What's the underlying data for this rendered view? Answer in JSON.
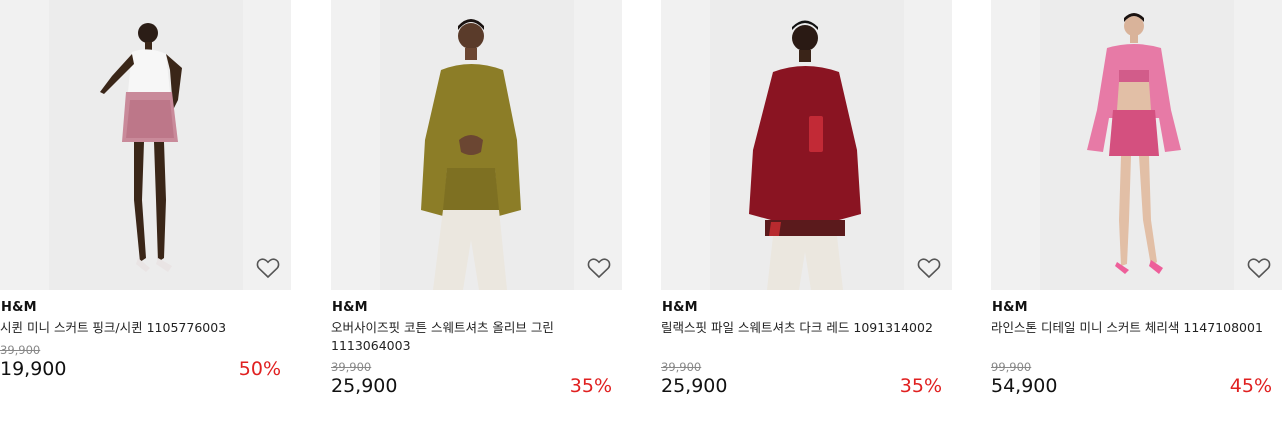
{
  "products": [
    {
      "brand": "H&M",
      "title": "시퀸 미니 스커트 핑크/시퀸 1105776003",
      "old_price": "39,900",
      "new_price": "19,900",
      "discount": "50%",
      "wishlist_icon": "heart-outline-icon"
    },
    {
      "brand": "H&M",
      "title": "오버사이즈핏 코튼 스웨트셔츠 올리브 그린 1113064003",
      "old_price": "39,900",
      "new_price": "25,900",
      "discount": "35%",
      "wishlist_icon": "heart-outline-icon"
    },
    {
      "brand": "H&M",
      "title": "릴랙스핏 파일 스웨트셔츠 다크 레드 1091314002",
      "old_price": "39,900",
      "new_price": "25,900",
      "discount": "35%",
      "wishlist_icon": "heart-outline-icon"
    },
    {
      "brand": "H&M",
      "title": "라인스톤 디테일 미니 스커트 체리색 1147108001",
      "old_price": "99,900",
      "new_price": "54,900",
      "discount": "45%",
      "wishlist_icon": "heart-outline-icon"
    }
  ],
  "colors": {
    "discount": "#e02020",
    "old_price": "#888888",
    "photo_bg": "#f1f1f1"
  }
}
